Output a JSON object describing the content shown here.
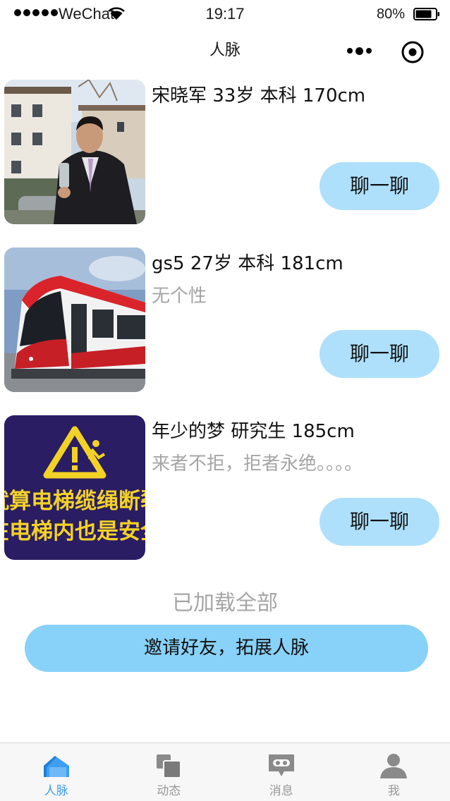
{
  "status_bar": {
    "carrier": "WeChat",
    "time": "19:17",
    "battery": "80%"
  },
  "nav": {
    "title": "人脉"
  },
  "contacts": [
    {
      "info": "宋晓军 33岁 本科 170cm",
      "signature": "",
      "chat_label": "聊一聊",
      "photo": "man-in-suit-photo"
    },
    {
      "info": "gs5 27岁 本科 181cm",
      "signature": "无个性",
      "chat_label": "聊一聊",
      "photo": "red-train-photo"
    },
    {
      "info": "年少的梦 研究生 185cm",
      "signature": "来者不拒，拒者永绝。。。。",
      "chat_label": "聊一聊",
      "photo": "elevator-safety-poster"
    }
  ],
  "poster_text": [
    "就算电梯缆绳断裂",
    "在电梯内也是安全"
  ],
  "loaded_all": "已加载全部",
  "invite_label": "邀请好友，拓展人脉",
  "tabs": [
    {
      "label": "人脉",
      "icon": "home-icon",
      "active": true
    },
    {
      "label": "动态",
      "icon": "feed-icon",
      "active": false
    },
    {
      "label": "消息",
      "icon": "message-icon",
      "active": false
    },
    {
      "label": "我",
      "icon": "profile-icon",
      "active": false
    }
  ],
  "colors": {
    "chat_button": "#aee0fb",
    "invite_button": "#88d1f8",
    "active_tab": "#3e9ff0",
    "inactive_tab": "#999999",
    "muted_text": "#a5a5a5"
  }
}
